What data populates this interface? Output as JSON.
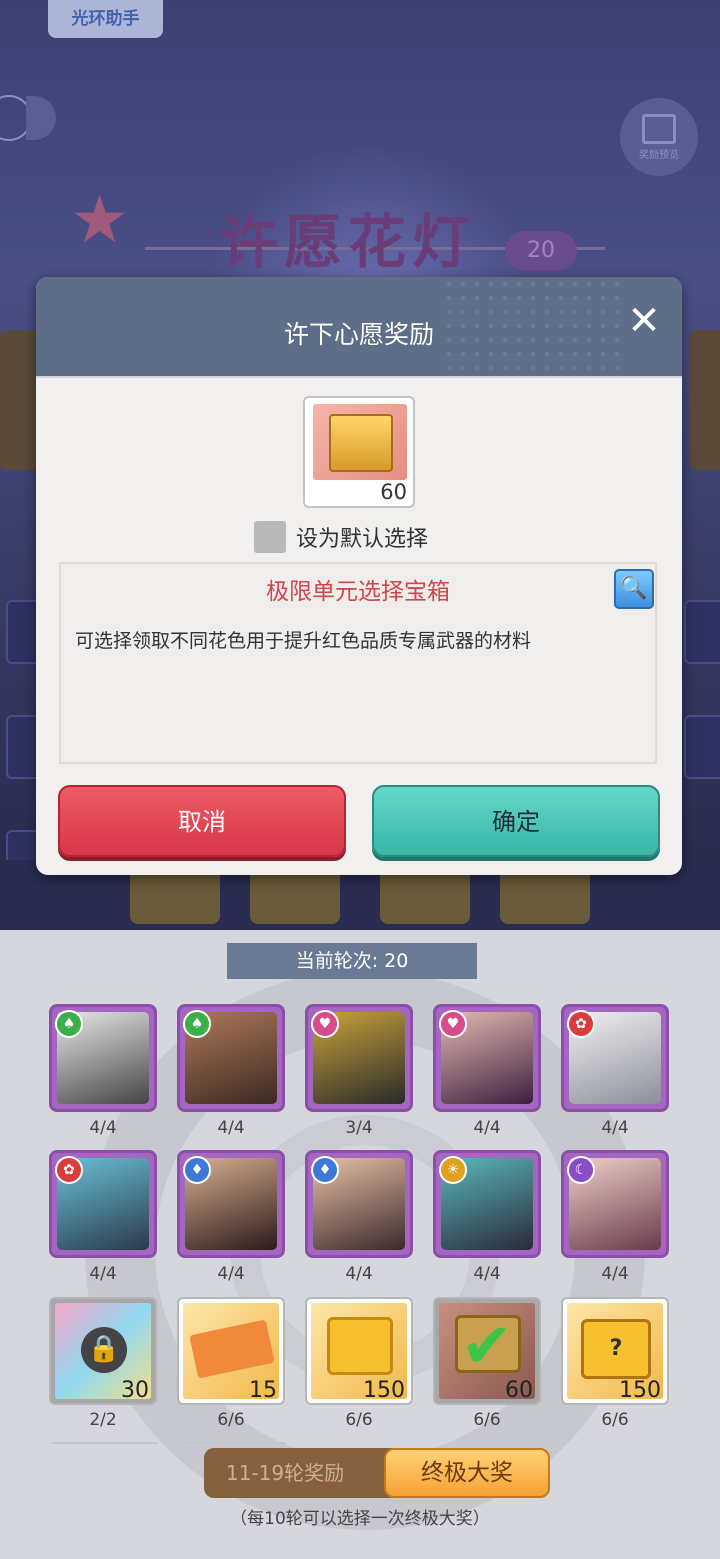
{
  "app": {
    "assistant_label": "光环助手",
    "event_title": "许愿花灯",
    "event_round": "20",
    "gift_label": "奖励预览"
  },
  "dialog": {
    "title": "许下心愿奖励",
    "close_icon": "close-icon",
    "item_count": "60",
    "default_choice_label": "设为默认选择",
    "item_name": "极限单元选择宝箱",
    "item_desc": "可选择领取不同花色用于提升红色品质专属武器的材料",
    "cancel_label": "取消",
    "confirm_label": "确定"
  },
  "panel": {
    "round_label": "当前轮次: 20",
    "heroes": [
      {
        "suit": "spade",
        "count": "4/4"
      },
      {
        "suit": "spade",
        "count": "4/4"
      },
      {
        "suit": "heart",
        "count": "3/4"
      },
      {
        "suit": "heart",
        "count": "4/4"
      },
      {
        "suit": "flower",
        "count": "4/4"
      },
      {
        "suit": "flower",
        "count": "4/4"
      },
      {
        "suit": "diamond",
        "count": "4/4"
      },
      {
        "suit": "diamond",
        "count": "4/4"
      },
      {
        "suit": "sun",
        "count": "4/4"
      },
      {
        "suit": "moon",
        "count": "4/4"
      }
    ],
    "rewards": [
      {
        "name": "locked-reward",
        "qty": "30",
        "count": "2/2"
      },
      {
        "name": "ticket-reward",
        "qty": "15",
        "count": "6/6"
      },
      {
        "name": "gold-chest-reward",
        "qty": "150",
        "count": "6/6"
      },
      {
        "name": "selected-chest-reward",
        "qty": "60",
        "count": "6/6"
      },
      {
        "name": "mystery-chest-reward",
        "qty": "150",
        "count": "6/6"
      }
    ],
    "tab_rounds": "11-19轮奖励",
    "tab_ultimate": "终极大奖",
    "hint": "（每10轮可以选择一次终极大奖）"
  }
}
